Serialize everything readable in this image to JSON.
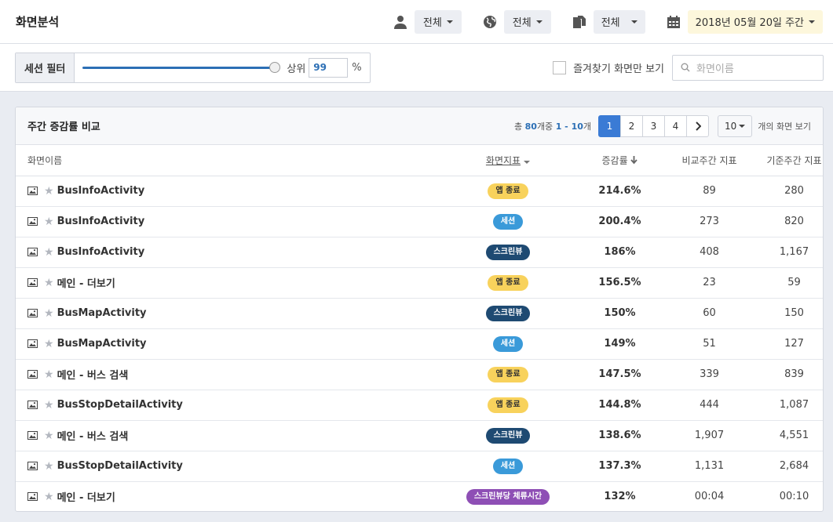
{
  "header": {
    "title": "화면분석",
    "user_filter": "전체",
    "region_filter": "전체",
    "doc_filter": "전체",
    "date": "2018년 05월 20일 주간"
  },
  "filterbar": {
    "session_label": "세션 필터",
    "slider_value_fraction": 1.0,
    "top_label": "상위",
    "top_value": "99",
    "percent": "%",
    "favorites_label": "즐겨찾기 화면만 보기",
    "search_placeholder": "화면이름"
  },
  "panel": {
    "title": "주간 증감률 비교",
    "count_prefix": "총 ",
    "total": "80",
    "count_mid": "개중 ",
    "range": "1 - 10",
    "count_suffix": "개",
    "pages": [
      "1",
      "2",
      "3",
      "4"
    ],
    "active_page": "1",
    "per_page": "10",
    "per_page_label": "개의 화면 보기"
  },
  "columns": {
    "name": "화면이름",
    "metric": "화면지표",
    "rate": "증감률",
    "compare": "비교주간 지표",
    "base": "기준주간 지표"
  },
  "rows": [
    {
      "name": "BusInfoActivity",
      "metric": "앱 종료",
      "metric_type": "app",
      "rate": "214.6%",
      "compare": "89",
      "base": "280"
    },
    {
      "name": "BusInfoActivity",
      "metric": "세션",
      "metric_type": "session",
      "rate": "200.4%",
      "compare": "273",
      "base": "820"
    },
    {
      "name": "BusInfoActivity",
      "metric": "스크린뷰",
      "metric_type": "screen",
      "rate": "186%",
      "compare": "408",
      "base": "1,167"
    },
    {
      "name": "메인 - 더보기",
      "metric": "앱 종료",
      "metric_type": "app",
      "rate": "156.5%",
      "compare": "23",
      "base": "59"
    },
    {
      "name": "BusMapActivity",
      "metric": "스크린뷰",
      "metric_type": "screen",
      "rate": "150%",
      "compare": "60",
      "base": "150"
    },
    {
      "name": "BusMapActivity",
      "metric": "세션",
      "metric_type": "session",
      "rate": "149%",
      "compare": "51",
      "base": "127"
    },
    {
      "name": "메인 - 버스 검색",
      "metric": "앱 종료",
      "metric_type": "app",
      "rate": "147.5%",
      "compare": "339",
      "base": "839"
    },
    {
      "name": "BusStopDetailActivity",
      "metric": "앱 종료",
      "metric_type": "app",
      "rate": "144.8%",
      "compare": "444",
      "base": "1,087"
    },
    {
      "name": "메인 - 버스 검색",
      "metric": "스크린뷰",
      "metric_type": "screen",
      "rate": "138.6%",
      "compare": "1,907",
      "base": "4,551"
    },
    {
      "name": "BusStopDetailActivity",
      "metric": "세션",
      "metric_type": "session",
      "rate": "137.3%",
      "compare": "1,131",
      "base": "2,684"
    },
    {
      "name": "메인 - 더보기",
      "metric": "스크린뷰당 체류시간",
      "metric_type": "dwell",
      "rate": "132%",
      "compare": "00:04",
      "base": "00:10"
    }
  ],
  "colors": {
    "accent": "#3a7bd5",
    "app": "#f8d25c",
    "session": "#3a9ad9",
    "screen": "#1e4a72",
    "dwell": "#8e4fb5"
  }
}
